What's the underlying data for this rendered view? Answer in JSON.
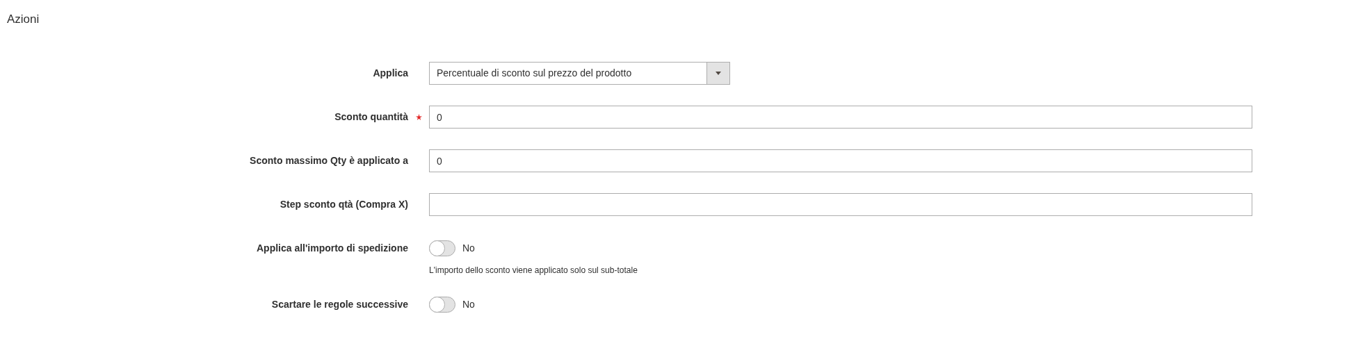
{
  "section": {
    "title": "Azioni"
  },
  "fields": [
    {
      "kind": "select",
      "label": "Applica",
      "required": false,
      "value": "Percentuale di sconto sul prezzo del prodotto"
    },
    {
      "kind": "input",
      "label": "Sconto quantità",
      "required": true,
      "value": "0"
    },
    {
      "kind": "input",
      "label": "Sconto massimo Qty è applicato a",
      "required": false,
      "value": "0"
    },
    {
      "kind": "input",
      "label": "Step sconto qtà (Compra X)",
      "required": false
    },
    {
      "kind": "toggle",
      "label": "Applica all'importo di spedizione",
      "required": false,
      "on": false,
      "state_text": "No",
      "note": "L'importo dello sconto viene applicato solo sul sub-totale"
    },
    {
      "kind": "toggle",
      "label": "Scartare le regole successive",
      "required": false,
      "on": false,
      "state_text": "No"
    }
  ]
}
